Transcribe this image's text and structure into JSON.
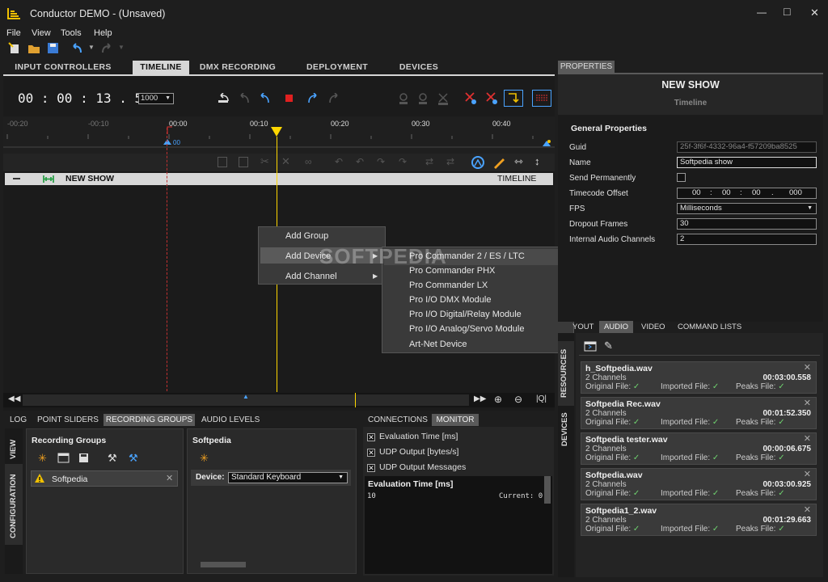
{
  "window": {
    "title": "Conductor DEMO - (Unsaved)",
    "min": "—",
    "max": "□",
    "close": "✕"
  },
  "menu": [
    "File",
    "View",
    "Tools",
    "Help"
  ],
  "tabs": {
    "items": [
      "INPUT CONTROLLERS",
      "TIMELINE",
      "DMX RECORDING",
      "DEPLOYMENT",
      "DEVICES"
    ],
    "active": "TIMELINE"
  },
  "timecode": {
    "value": "00 : 00 : 13 . 564",
    "rate": "1000"
  },
  "ruler": {
    "ticks": [
      "-00:20",
      "-00:10",
      "00:00",
      "00:10",
      "00:20",
      "00:30",
      "00:40"
    ],
    "marker": "00"
  },
  "track": {
    "name": "NEW SHOW",
    "type": "TIMELINE"
  },
  "context_menu": {
    "items": [
      "Add Group",
      "Add Device",
      "Add Channel"
    ],
    "highlighted": "Add Device"
  },
  "submenu": {
    "items": [
      "Pro Commander 2 / ES / LTC",
      "Pro Commander PHX",
      "Pro Commander LX",
      "Pro I/O DMX Module",
      "Pro I/O Digital/Relay Module",
      "Pro I/O Analog/Servo Module",
      "Art-Net Device"
    ],
    "highlighted": "Pro Commander 2 / ES / LTC"
  },
  "watermark": "SOFTPEDIA",
  "properties": {
    "tab": "PROPERTIES",
    "title": "NEW SHOW",
    "subtitle": "Timeline",
    "section": "General Properties",
    "guid_label": "Guid",
    "guid": "25f-3f6f-4332-96a4-f57209ba8525",
    "name_label": "Name",
    "name": "Softpedia show",
    "send_label": "Send Permanently",
    "tc_label": "Timecode Offset",
    "tc": [
      "00",
      ":",
      "00",
      ":",
      "00",
      ".",
      "000"
    ],
    "fps_label": "FPS",
    "fps": "Milliseconds",
    "dropout_label": "Dropout Frames",
    "dropout": "30",
    "audio_ch_label": "Internal Audio Channels",
    "audio_ch": "2"
  },
  "resources": {
    "tabs": [
      "YOUT",
      "AUDIO",
      "VIDEO",
      "COMMAND LISTS"
    ],
    "active": "AUDIO",
    "side_tabs": [
      "RESOURCES",
      "DEVICES"
    ],
    "labels": {
      "orig": "Original File:",
      "imp": "Imported File:",
      "peaks": "Peaks File:",
      "check": "✓"
    },
    "files": [
      {
        "name": "h_Softpedia.wav",
        "channels": "2 Channels",
        "duration": "00:03:00.558"
      },
      {
        "name": "Softpedia Rec.wav",
        "channels": "2 Channels",
        "duration": "00:01:52.350"
      },
      {
        "name": "Softpedia tester.wav",
        "channels": "2 Channels",
        "duration": "00:00:06.675"
      },
      {
        "name": "Softpedia.wav",
        "channels": "2 Channels",
        "duration": "00:03:00.925"
      },
      {
        "name": "Softpedia1_2.wav",
        "channels": "2 Channels",
        "duration": "00:01:29.663"
      }
    ]
  },
  "bottom": {
    "tabs": [
      "LOG",
      "POINT SLIDERS",
      "RECORDING GROUPS",
      "AUDIO LEVELS"
    ],
    "active": "RECORDING GROUPS",
    "side_tabs": [
      "VIEW",
      "CONFIGURATION"
    ],
    "groups_title": "Recording Groups",
    "group_item": "Softpedia",
    "detail_title": "Softpedia",
    "device_label": "Device:",
    "device_value": "Standard Keyboard"
  },
  "monitor": {
    "tabs": [
      "CONNECTIONS",
      "MONITOR"
    ],
    "active": "MONITOR",
    "checks": [
      "Evaluation Time [ms]",
      "UDP Output [bytes/s]",
      "UDP Output Messages"
    ],
    "graph_title": "Evaluation Time [ms]",
    "graph_value": "10",
    "current": "Current: 0"
  },
  "colors": {
    "accent": "#f5c400",
    "playhead": "#ffd700",
    "active_tab": "#d6d6d6",
    "record": "#e02020"
  }
}
